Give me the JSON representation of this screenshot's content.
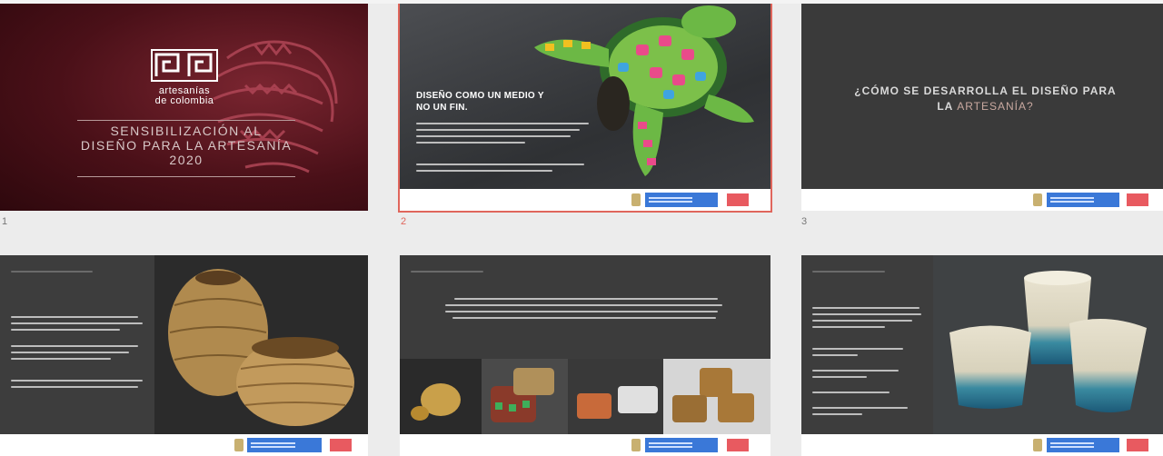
{
  "slides": [
    {
      "number": "1",
      "logo_text": [
        "artesanías",
        "de colombia"
      ],
      "title_lines": [
        "SENSIBILIZACIÓN AL",
        "DISEÑO PARA LA ARTESANÍA",
        "2020"
      ]
    },
    {
      "number": "2",
      "heading_lines": [
        "DISEÑO COMO UN MEDIO Y",
        "NO UN FIN."
      ],
      "selected": true
    },
    {
      "number": "3",
      "question_lines": [
        "¿CÓMO SE DESARROLLA EL DISEÑO PARA",
        "LA ",
        "ARTESANÍA?"
      ]
    },
    {
      "number": ""
    },
    {
      "number": ""
    },
    {
      "number": ""
    }
  ],
  "colors": {
    "selection": "#e0665c",
    "slide_dark": "#3a3a3a",
    "brand_red": "#e85a60",
    "brand_blue": "#3a78d8"
  }
}
